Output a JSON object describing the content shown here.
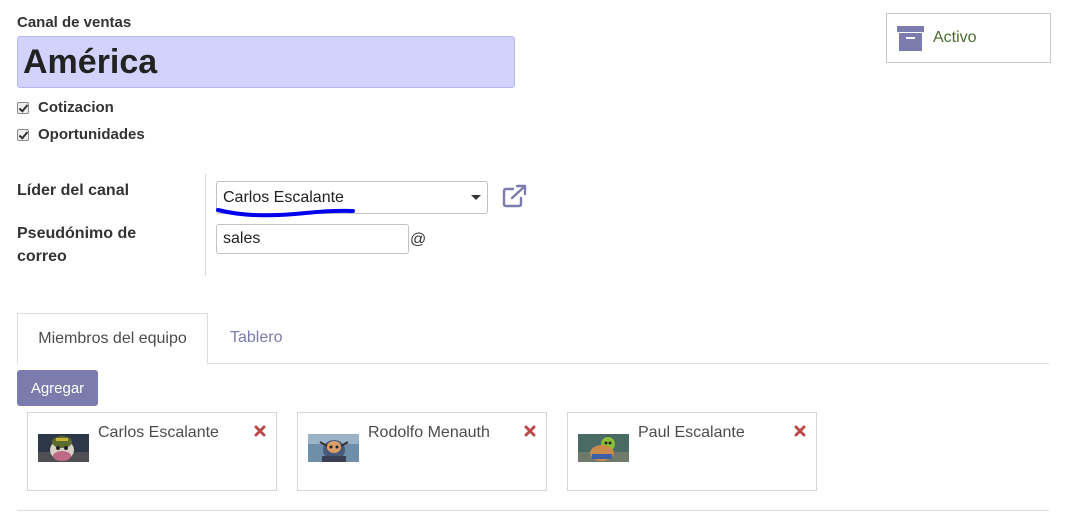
{
  "header": {
    "channel_label": "Canal de ventas",
    "channel_name": "América",
    "checkboxes": [
      {
        "label": "Cotizacion",
        "checked": true
      },
      {
        "label": "Oportunidades",
        "checked": true
      }
    ],
    "status_button_label": "Activo",
    "status_icon": "archive-icon"
  },
  "form": {
    "leader_label": "Líder del canal",
    "leader_value": "Carlos Escalante",
    "alias_label_line1": "Pseudónimo de",
    "alias_label_line2": "correo",
    "alias_value": "sales",
    "alias_suffix": "@"
  },
  "tabs": [
    {
      "label": "Miembros del equipo",
      "active": true
    },
    {
      "label": "Tablero",
      "active": false
    }
  ],
  "members": {
    "add_button_label": "Agregar",
    "items": [
      {
        "name": "Carlos Escalante"
      },
      {
        "name": "Rodolfo Menauth"
      },
      {
        "name": "Paul Escalante"
      }
    ]
  },
  "colors": {
    "accent": "#7c7bad",
    "name_highlight": "#d3d2fc",
    "active_text": "#4a6a2f",
    "remove_icon": "#b94a48",
    "annotation_underline": "#0000ee"
  }
}
